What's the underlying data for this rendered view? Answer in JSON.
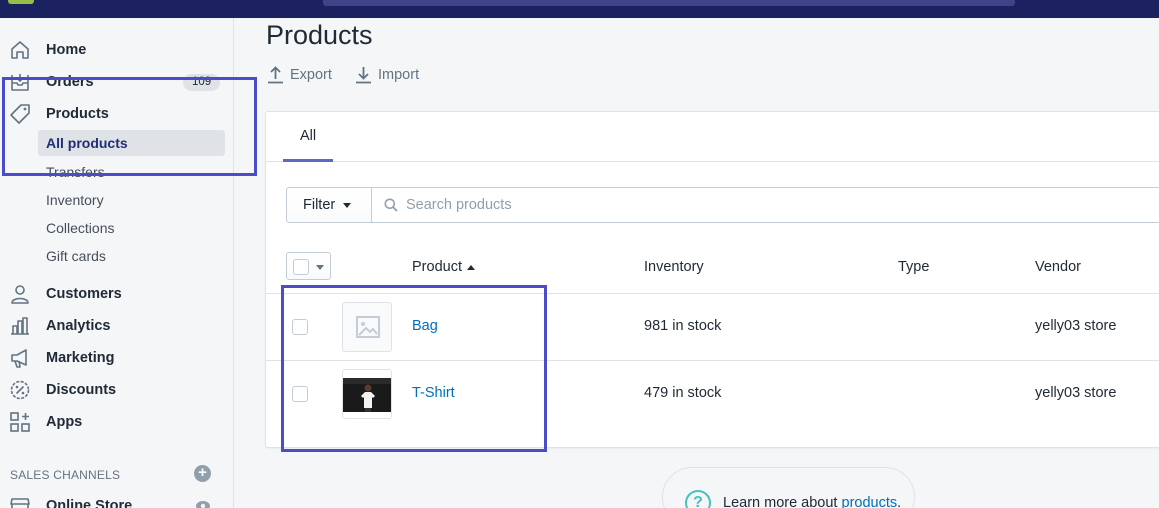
{
  "sidebar": {
    "items": [
      {
        "label": "Home",
        "icon": "home-icon"
      },
      {
        "label": "Orders",
        "icon": "orders-icon",
        "badge": "109"
      },
      {
        "label": "Products",
        "icon": "tag-icon"
      },
      {
        "label": "Customers",
        "icon": "person-icon"
      },
      {
        "label": "Analytics",
        "icon": "bar-chart-icon"
      },
      {
        "label": "Marketing",
        "icon": "megaphone-icon"
      },
      {
        "label": "Discounts",
        "icon": "discount-icon"
      },
      {
        "label": "Apps",
        "icon": "apps-icon"
      }
    ],
    "product_sub": [
      "All products",
      "Transfers",
      "Inventory",
      "Collections",
      "Gift cards"
    ],
    "sales_channels_title": "SALES CHANNELS",
    "online_store": "Online Store"
  },
  "main": {
    "title": "Products",
    "export_label": "Export",
    "import_label": "Import",
    "tab_all": "All",
    "filter_label": "Filter",
    "search_placeholder": "Search products",
    "columns": {
      "product": "Product",
      "inventory": "Inventory",
      "type": "Type",
      "vendor": "Vendor"
    },
    "rows": [
      {
        "name": "Bag",
        "inventory": "981 in stock",
        "type": "",
        "vendor": "yelly03 store"
      },
      {
        "name": "T-Shirt",
        "inventory": "479 in stock",
        "type": "",
        "vendor": "yelly03 store"
      }
    ],
    "learn_prefix": "Learn more about ",
    "learn_link": "products",
    "learn_suffix": "."
  },
  "colors": {
    "topbar": "#1c2260",
    "link": "#006fbb",
    "highlight": "#4b4dc7",
    "tab_underline": "#5c6ac4"
  }
}
